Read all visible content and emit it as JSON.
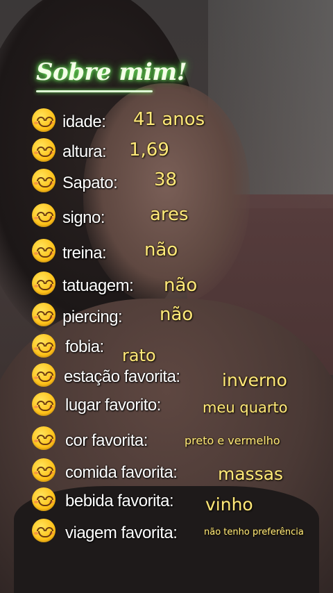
{
  "title": "Sobre mim!",
  "rows": [
    {
      "label": "idade:",
      "value": "41  anos"
    },
    {
      "label": "altura:",
      "value": "1,69"
    },
    {
      "label": "Sapato:",
      "value": "38"
    },
    {
      "label": "signo:",
      "value": "ares"
    },
    {
      "label": "treina:",
      "value": "não"
    },
    {
      "label": "tatuagem:",
      "value": "não"
    },
    {
      "label": "piercing:",
      "value": "não"
    },
    {
      "label": "fobia:",
      "value": "rato"
    },
    {
      "label": "estação favorita:",
      "value": "inverno"
    },
    {
      "label": "lugar favorito:",
      "value": "meu quarto"
    },
    {
      "label": "cor favorita:",
      "value": "preto e vermelho"
    },
    {
      "label": "comida favorita:",
      "value": "massas"
    },
    {
      "label": "bebida favorita:",
      "value": "vinho"
    },
    {
      "label": "viagem  favorita:",
      "value": "não tenho preferência"
    }
  ],
  "icons": {
    "row_icon": "smiling-face-emoji"
  },
  "colors": {
    "title_glow": "#46d23a",
    "value_text": "#ffe97a",
    "label_text": "#ffffff"
  }
}
